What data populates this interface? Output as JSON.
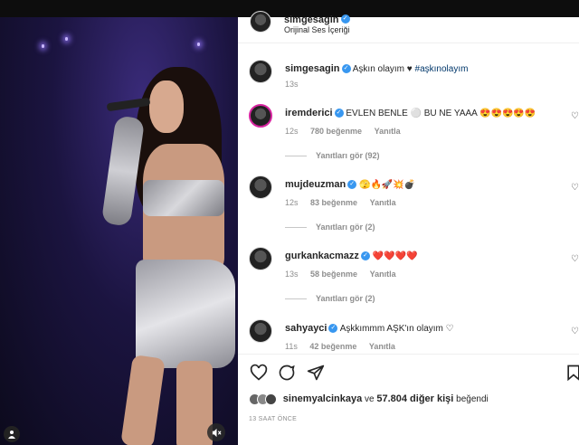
{
  "post": {
    "author": "simgesagin",
    "audio": "Orijinal Ses İçeriği"
  },
  "caption": {
    "author": "simgesagin",
    "text": "Aşkın olayım ♥",
    "hashtag": "#aşkınolayım",
    "time": "13s"
  },
  "comments": [
    {
      "user": "iremderici",
      "text": "EVLEN BENLE ⚪ BU NE YAAA 😍😍😍😍😍",
      "time": "12s",
      "likes": "780 beğenme",
      "reply": "Yanıtla",
      "replies": "Yanıtları gör (92)"
    },
    {
      "user": "mujdeuzman",
      "text": "🫣🔥🚀💥💣",
      "time": "12s",
      "likes": "83 beğenme",
      "reply": "Yanıtla",
      "replies": "Yanıtları gör (2)"
    },
    {
      "user": "gurkankacmazz",
      "text": "❤️❤️❤️❤️",
      "time": "13s",
      "likes": "58 beğenme",
      "reply": "Yanıtla",
      "replies": "Yanıtları gör (2)"
    },
    {
      "user": "sahyayci",
      "text": "Aşkkımmm AŞK'ın olayım ♡",
      "time": "11s",
      "likes": "42 beğenme",
      "reply": "Yanıtla"
    }
  ],
  "likes": {
    "first": "sinemyalcinkaya",
    "connector": "ve",
    "rest": "57.804 diğer kişi",
    "suffix": "beğendi"
  },
  "timeago": "13 SAAT ÖNCE",
  "icons": [
    "heart-icon",
    "comment-icon",
    "share-icon",
    "bookmark-icon",
    "mute-icon",
    "user-tag-icon",
    "verified-icon"
  ],
  "colors": {
    "verified": "#3897f0",
    "link": "#00376b",
    "muted": "#8e8e8e"
  }
}
